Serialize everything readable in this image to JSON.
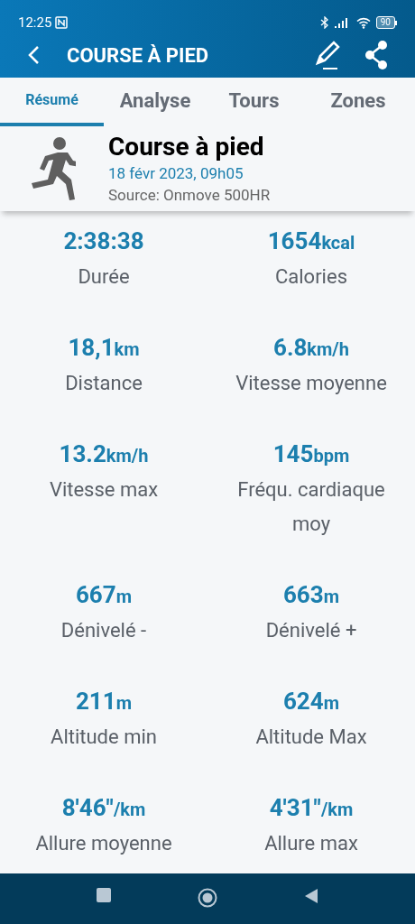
{
  "status_bar": {
    "time": "12:25",
    "battery": "90"
  },
  "app_bar": {
    "title": "COURSE À PIED"
  },
  "tabs": [
    {
      "label": "Résumé",
      "selected": true
    },
    {
      "label": "Analyse",
      "selected": false
    },
    {
      "label": "Tours",
      "selected": false
    },
    {
      "label": "Zones",
      "selected": false
    }
  ],
  "activity": {
    "title": "Course à pied",
    "date": "18 févr 2023, 09h05",
    "source": "Source: Onmove 500HR"
  },
  "stats": [
    {
      "value": "2:38:38",
      "label": "Durée"
    },
    {
      "value": "1654",
      "unit": "kcal",
      "label": "Calories"
    },
    {
      "value": "18,1",
      "unit": "km",
      "label": "Distance"
    },
    {
      "value": "6.8",
      "unit": "km/h",
      "label": "Vitesse moyenne"
    },
    {
      "value": "13.2",
      "unit": "km/h",
      "label": "Vitesse max"
    },
    {
      "value": "145",
      "unit": "bpm",
      "label": "Fréqu. cardiaque moy"
    },
    {
      "value": "667",
      "unit": "m",
      "label": "Dénivelé -"
    },
    {
      "value": "663",
      "unit": "m",
      "label": "Dénivelé +"
    },
    {
      "value": "211",
      "unit": "m",
      "label": "Altitude min"
    },
    {
      "value": "624",
      "unit": "m",
      "label": "Altitude Max"
    },
    {
      "value": "8'46\"",
      "unit": "/km",
      "label": "Allure moyenne"
    },
    {
      "value": "4'31\"",
      "unit": "/km",
      "label": "Allure max"
    }
  ]
}
